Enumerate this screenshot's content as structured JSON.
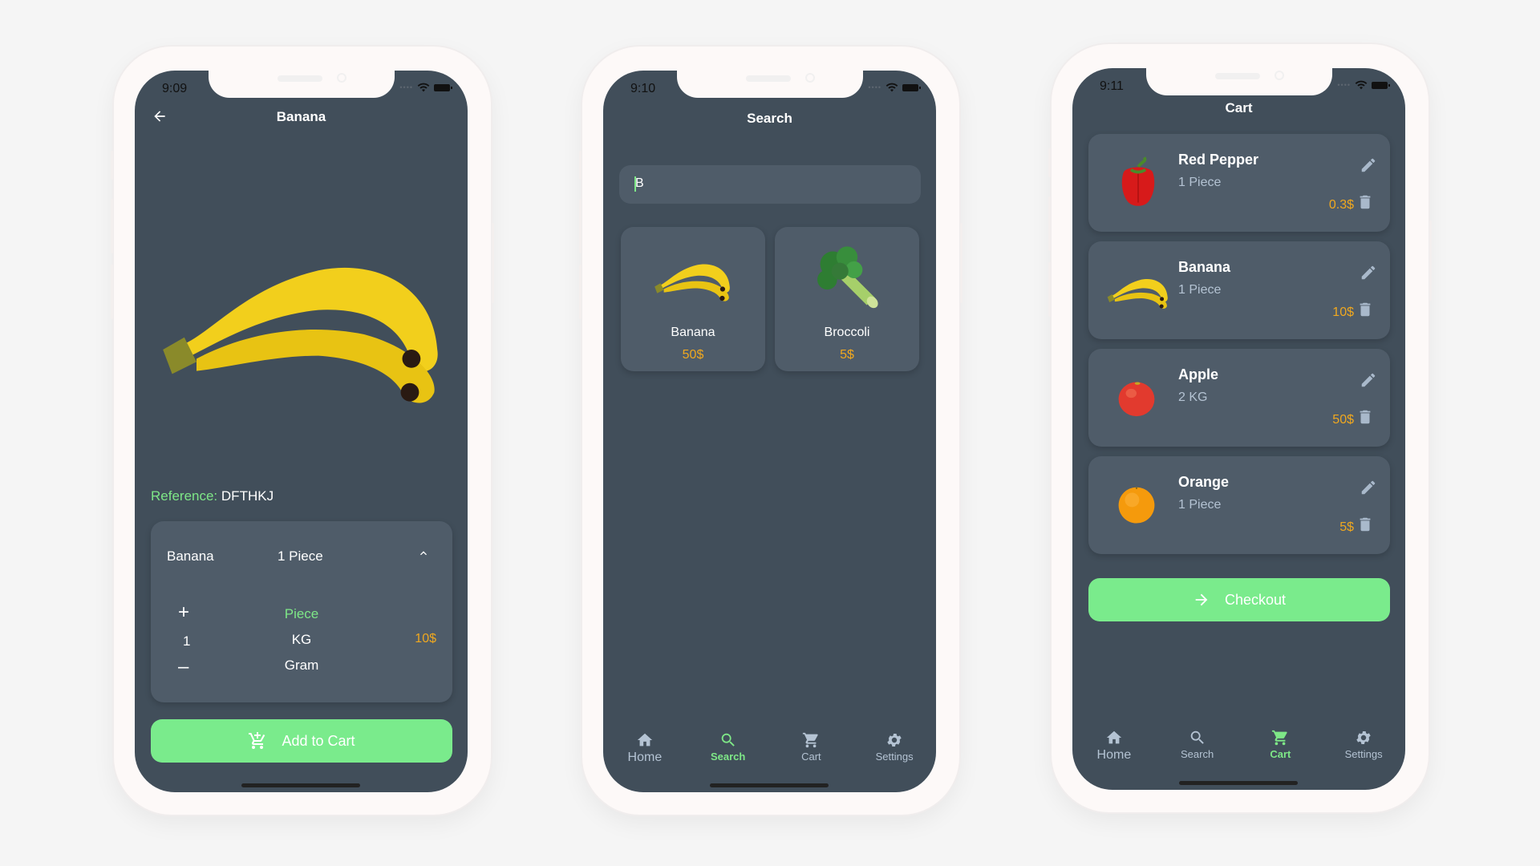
{
  "phones": [
    {
      "status": {
        "time": "9:09"
      },
      "header": {
        "title": "Banana",
        "back_icon": "arrow-left-icon"
      },
      "product": {
        "image": "banana-image",
        "reference_label": "Reference:",
        "reference_value": "DFTHKJ"
      },
      "selector": {
        "product_name": "Banana",
        "summary": "1 Piece",
        "collapse_icon": "chevron-up-icon",
        "increment_label": "+",
        "quantity": "1",
        "decrement_label": "–",
        "units": [
          "Piece",
          "KG",
          "Gram"
        ],
        "selected_unit": "Piece",
        "price": "10$"
      },
      "add_to_cart": {
        "label": "Add to Cart",
        "icon": "cart-plus-icon"
      }
    },
    {
      "status": {
        "time": "9:10"
      },
      "header": {
        "title": "Search"
      },
      "search": {
        "value": "B",
        "placeholder": ""
      },
      "results": [
        {
          "name": "Banana",
          "price": "50$",
          "image": "banana-image"
        },
        {
          "name": "Broccoli",
          "price": "5$",
          "image": "broccoli-image"
        }
      ],
      "nav": [
        {
          "label": "Home",
          "icon": "home-icon",
          "active": false
        },
        {
          "label": "Search",
          "icon": "search-icon",
          "active": true
        },
        {
          "label": "Cart",
          "icon": "cart-icon",
          "active": false
        },
        {
          "label": "Settings",
          "icon": "gear-icon",
          "active": false
        }
      ]
    },
    {
      "status": {
        "time": "9:11"
      },
      "header": {
        "title": "Cart"
      },
      "items": [
        {
          "name": "Red Pepper",
          "qty": "1 Piece",
          "price": "0.3$",
          "image": "red-pepper-image"
        },
        {
          "name": "Banana",
          "qty": "1 Piece",
          "price": "10$",
          "image": "banana-image"
        },
        {
          "name": "Apple",
          "qty": "2 KG",
          "price": "50$",
          "image": "apple-image"
        },
        {
          "name": "Orange",
          "qty": "1 Piece",
          "price": "5$",
          "image": "orange-image"
        }
      ],
      "checkout": {
        "label": "Checkout",
        "icon": "arrow-right-icon"
      },
      "nav": [
        {
          "label": "Home",
          "icon": "home-icon",
          "active": false
        },
        {
          "label": "Search",
          "icon": "search-icon",
          "active": false
        },
        {
          "label": "Cart",
          "icon": "cart-icon",
          "active": true
        },
        {
          "label": "Settings",
          "icon": "gear-icon",
          "active": false
        }
      ]
    }
  ],
  "colors": {
    "screen_bg": "#414e5a",
    "card_bg": "#4f5c69",
    "accent_green": "#7aeb8c",
    "price_orange": "#f0a81f",
    "muted_text": "#b4c3d3",
    "page_bg": "#f5f5f5"
  }
}
